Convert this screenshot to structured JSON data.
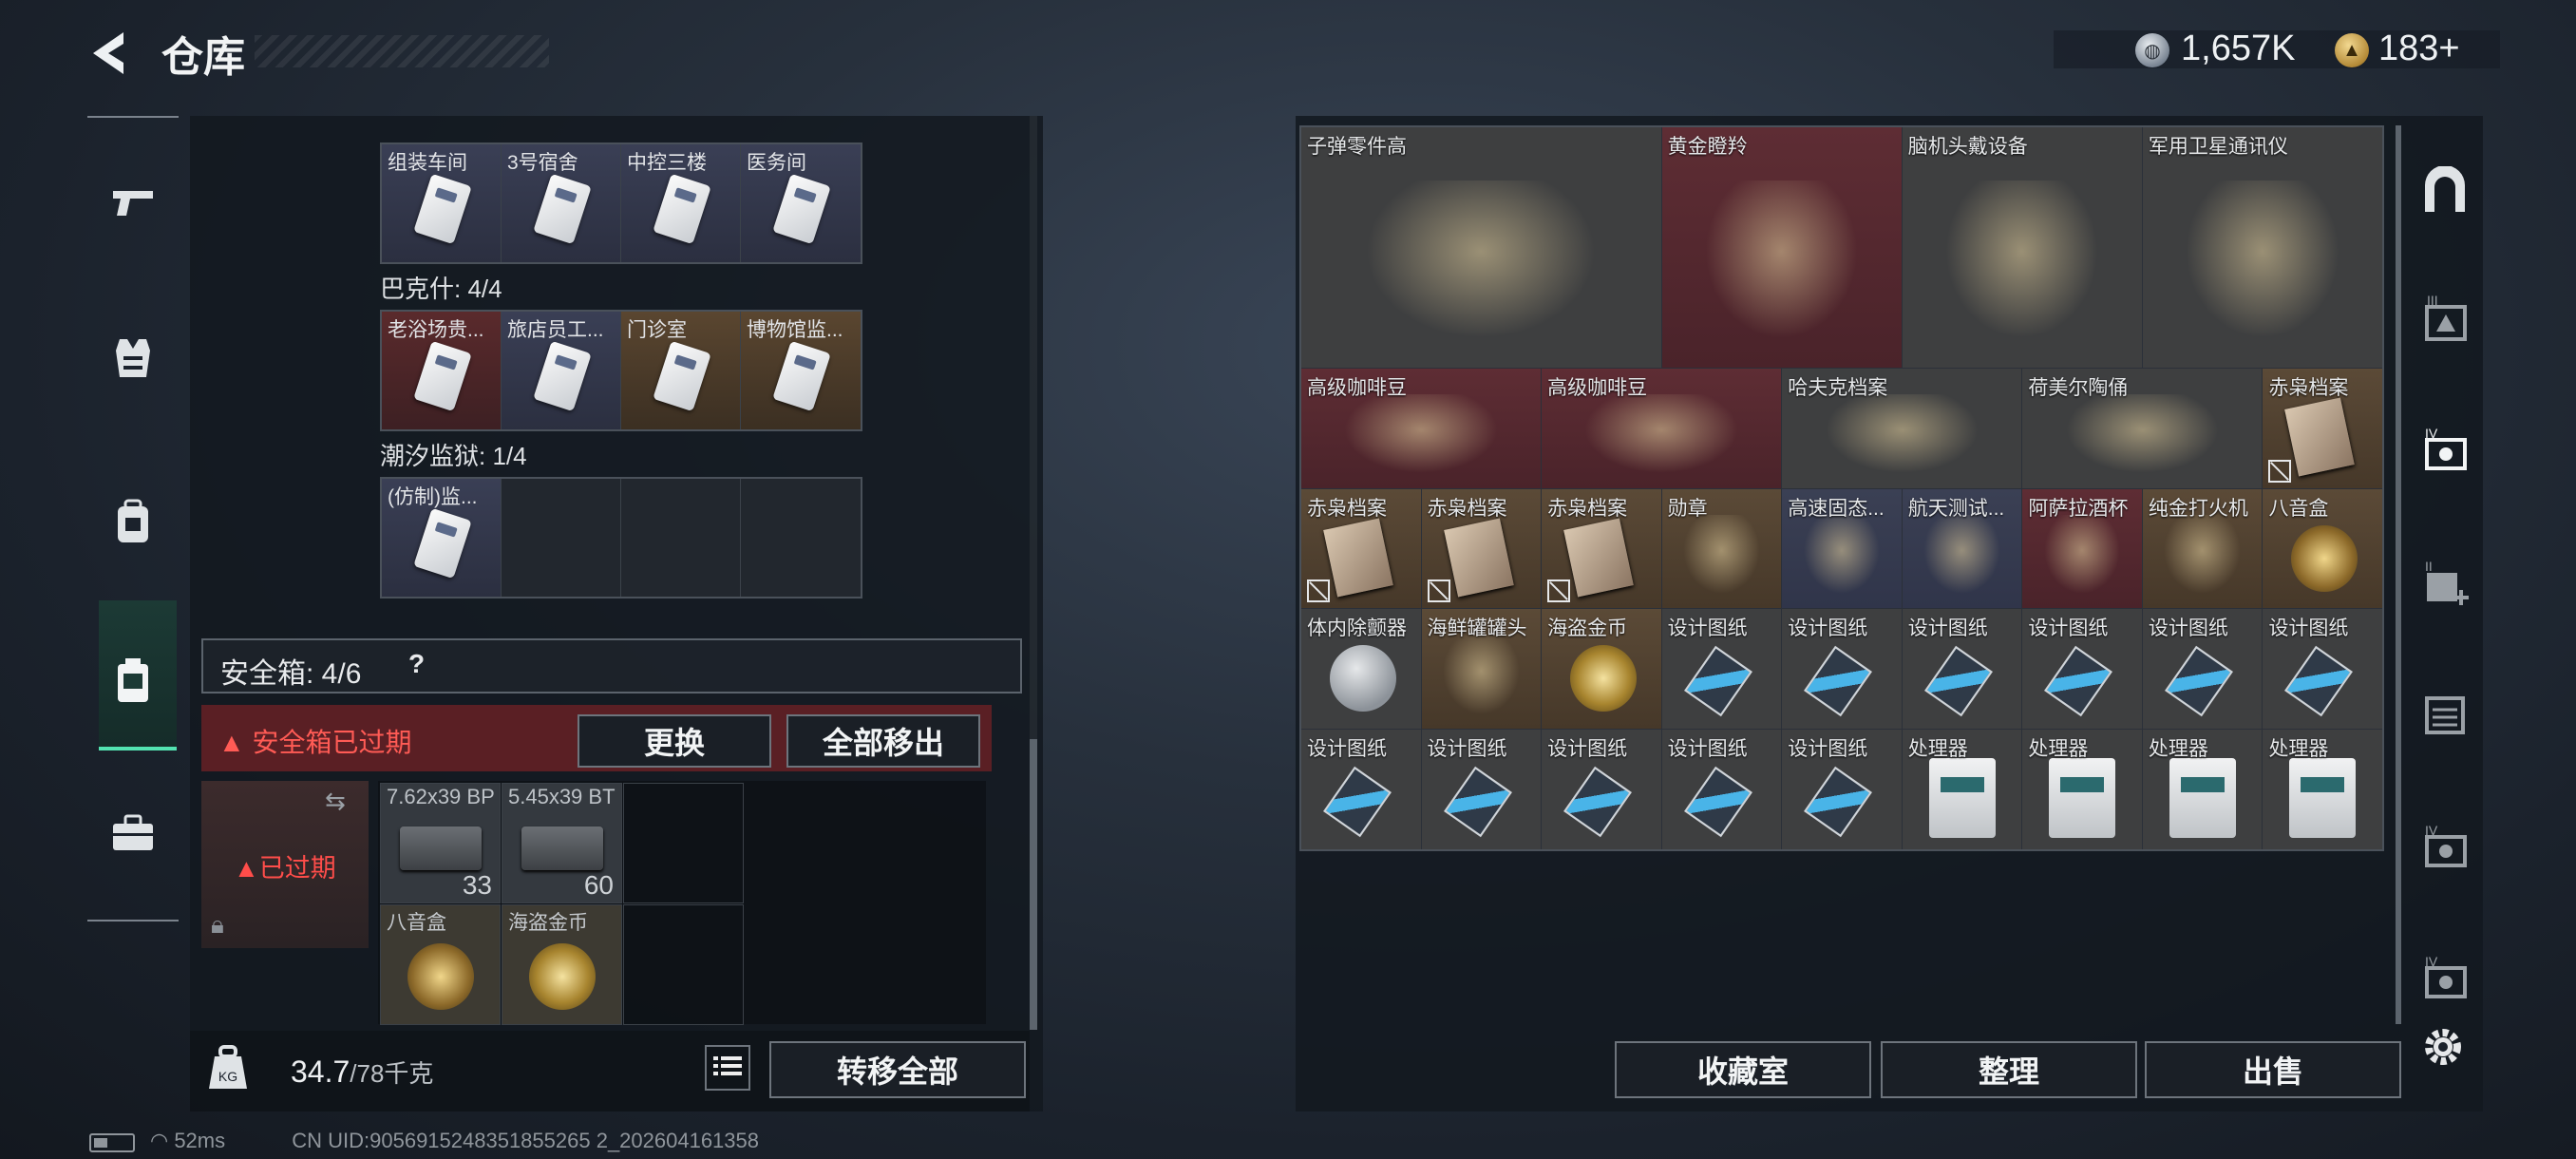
{
  "header": {
    "title": "仓库",
    "silver": "1,657K",
    "gold": "183+"
  },
  "key_sections": [
    {
      "label": "",
      "cards": [
        {
          "name": "组装车间",
          "tone": "blue"
        },
        {
          "name": "3号宿舍",
          "tone": "blue"
        },
        {
          "name": "中控三楼",
          "tone": "blue"
        },
        {
          "name": "医务间",
          "tone": "blue"
        }
      ]
    },
    {
      "label": "巴克什: 4/4",
      "cards": [
        {
          "name": "老浴场贵...",
          "tone": "red"
        },
        {
          "name": "旅店员工...",
          "tone": "blue"
        },
        {
          "name": "门诊室",
          "tone": "gold"
        },
        {
          "name": "博物馆监...",
          "tone": "gold"
        }
      ]
    },
    {
      "label": "潮汐监狱: 1/4",
      "cards": [
        {
          "name": "(仿制)监...",
          "tone": "blue"
        },
        {
          "name": "",
          "tone": "empty"
        },
        {
          "name": "",
          "tone": "empty"
        },
        {
          "name": "",
          "tone": "empty"
        }
      ]
    }
  ],
  "safe": {
    "label": "安全箱: 4/6",
    "help": "?",
    "expired_banner": "安全箱已过期",
    "replace": "更换",
    "move_all": "全部移出",
    "expired_tag": "已过期"
  },
  "safe_items": [
    {
      "name": "7.62x39 BP",
      "count": "33"
    },
    {
      "name": "5.45x39 BT",
      "count": "60"
    },
    {
      "name": "八音盒",
      "count": ""
    },
    {
      "name": "海盗金币",
      "count": ""
    }
  ],
  "weight": {
    "current": "34.7",
    "max": "/78千克"
  },
  "transfer_all": "转移全部",
  "status": {
    "ping": "52ms",
    "uid": "CN UID:9056915248351855265 2_202604161358"
  },
  "stash_items": [
    {
      "name": "子弹零件高",
      "tone": "grey",
      "col": 1,
      "row": 1,
      "w": 3,
      "h": 2
    },
    {
      "name": "黄金瞪羚",
      "tone": "red",
      "col": 4,
      "row": 1,
      "w": 2,
      "h": 2
    },
    {
      "name": "脑机头戴设备",
      "tone": "grey",
      "col": 6,
      "row": 1,
      "w": 2,
      "h": 2
    },
    {
      "name": "军用卫星通讯仪",
      "tone": "grey",
      "col": 8,
      "row": 1,
      "w": 2,
      "h": 2
    },
    {
      "name": "高级咖啡豆",
      "tone": "red",
      "col": 1,
      "row": 3,
      "w": 2,
      "h": 1
    },
    {
      "name": "高级咖啡豆",
      "tone": "red",
      "col": 3,
      "row": 3,
      "w": 2,
      "h": 1
    },
    {
      "name": "哈夫克档案",
      "tone": "grey",
      "col": 5,
      "row": 3,
      "w": 2,
      "h": 1
    },
    {
      "name": "荷美尔陶俑",
      "tone": "grey",
      "col": 7,
      "row": 3,
      "w": 2,
      "h": 1
    },
    {
      "name": "赤枭档案",
      "tone": "gold",
      "col": 9,
      "row": 3,
      "w": 1,
      "h": 1,
      "flag": true
    },
    {
      "name": "赤枭档案",
      "tone": "gold",
      "col": 1,
      "row": 4,
      "w": 1,
      "h": 1,
      "flag": true
    },
    {
      "name": "赤枭档案",
      "tone": "gold",
      "col": 2,
      "row": 4,
      "w": 1,
      "h": 1,
      "flag": true
    },
    {
      "name": "赤枭档案",
      "tone": "gold",
      "col": 3,
      "row": 4,
      "w": 1,
      "h": 1,
      "flag": true
    },
    {
      "name": "勋章",
      "tone": "gold",
      "col": 4,
      "row": 4,
      "w": 1,
      "h": 1
    },
    {
      "name": "高速固态...",
      "tone": "blue",
      "col": 5,
      "row": 4,
      "w": 1,
      "h": 1
    },
    {
      "name": "航天测试...",
      "tone": "blue",
      "col": 6,
      "row": 4,
      "w": 1,
      "h": 1
    },
    {
      "name": "阿萨拉酒杯",
      "tone": "red",
      "col": 7,
      "row": 4,
      "w": 1,
      "h": 1
    },
    {
      "name": "纯金打火机",
      "tone": "gold",
      "col": 8,
      "row": 4,
      "w": 1,
      "h": 1
    },
    {
      "name": "八音盒",
      "tone": "gold",
      "col": 9,
      "row": 4,
      "w": 1,
      "h": 1
    },
    {
      "name": "体内除颤器",
      "tone": "grey",
      "col": 1,
      "row": 5,
      "w": 1,
      "h": 1
    },
    {
      "name": "海鲜罐罐头",
      "tone": "gold",
      "col": 2,
      "row": 5,
      "w": 1,
      "h": 1
    },
    {
      "name": "海盗金币",
      "tone": "gold",
      "col": 3,
      "row": 5,
      "w": 1,
      "h": 1
    },
    {
      "name": "设计图纸",
      "tone": "grey",
      "col": 4,
      "row": 5,
      "w": 1,
      "h": 1
    },
    {
      "name": "设计图纸",
      "tone": "grey",
      "col": 5,
      "row": 5,
      "w": 1,
      "h": 1
    },
    {
      "name": "设计图纸",
      "tone": "grey",
      "col": 6,
      "row": 5,
      "w": 1,
      "h": 1
    },
    {
      "name": "设计图纸",
      "tone": "grey",
      "col": 7,
      "row": 5,
      "w": 1,
      "h": 1
    },
    {
      "name": "设计图纸",
      "tone": "grey",
      "col": 8,
      "row": 5,
      "w": 1,
      "h": 1
    },
    {
      "name": "设计图纸",
      "tone": "grey",
      "col": 9,
      "row": 5,
      "w": 1,
      "h": 1
    },
    {
      "name": "设计图纸",
      "tone": "grey",
      "col": 1,
      "row": 6,
      "w": 1,
      "h": 1
    },
    {
      "name": "设计图纸",
      "tone": "grey",
      "col": 2,
      "row": 6,
      "w": 1,
      "h": 1
    },
    {
      "name": "设计图纸",
      "tone": "grey",
      "col": 3,
      "row": 6,
      "w": 1,
      "h": 1
    },
    {
      "name": "设计图纸",
      "tone": "grey",
      "col": 4,
      "row": 6,
      "w": 1,
      "h": 1
    },
    {
      "name": "设计图纸",
      "tone": "grey",
      "col": 5,
      "row": 6,
      "w": 1,
      "h": 1
    },
    {
      "name": "处理器",
      "tone": "grey",
      "col": 6,
      "row": 6,
      "w": 1,
      "h": 1
    },
    {
      "name": "处理器",
      "tone": "grey",
      "col": 7,
      "row": 6,
      "w": 1,
      "h": 1
    },
    {
      "name": "处理器",
      "tone": "grey",
      "col": 8,
      "row": 6,
      "w": 1,
      "h": 1
    },
    {
      "name": "处理器",
      "tone": "grey",
      "col": 9,
      "row": 6,
      "w": 1,
      "h": 1
    }
  ],
  "bottom_buttons": {
    "vault": "收藏室",
    "sort": "整理",
    "sell": "出售"
  },
  "right_nav_icons": [
    "stash-tab-icon",
    "level3-loadout-icon",
    "level4-loadout-icon",
    "add-loadout-icon",
    "loadout-list-icon",
    "level4-loadout-icon",
    "level4-loadout-icon"
  ],
  "colors": {
    "accent": "#53e3b1",
    "warning": "#ff5b55",
    "expired_bg": "#5a1f24"
  }
}
